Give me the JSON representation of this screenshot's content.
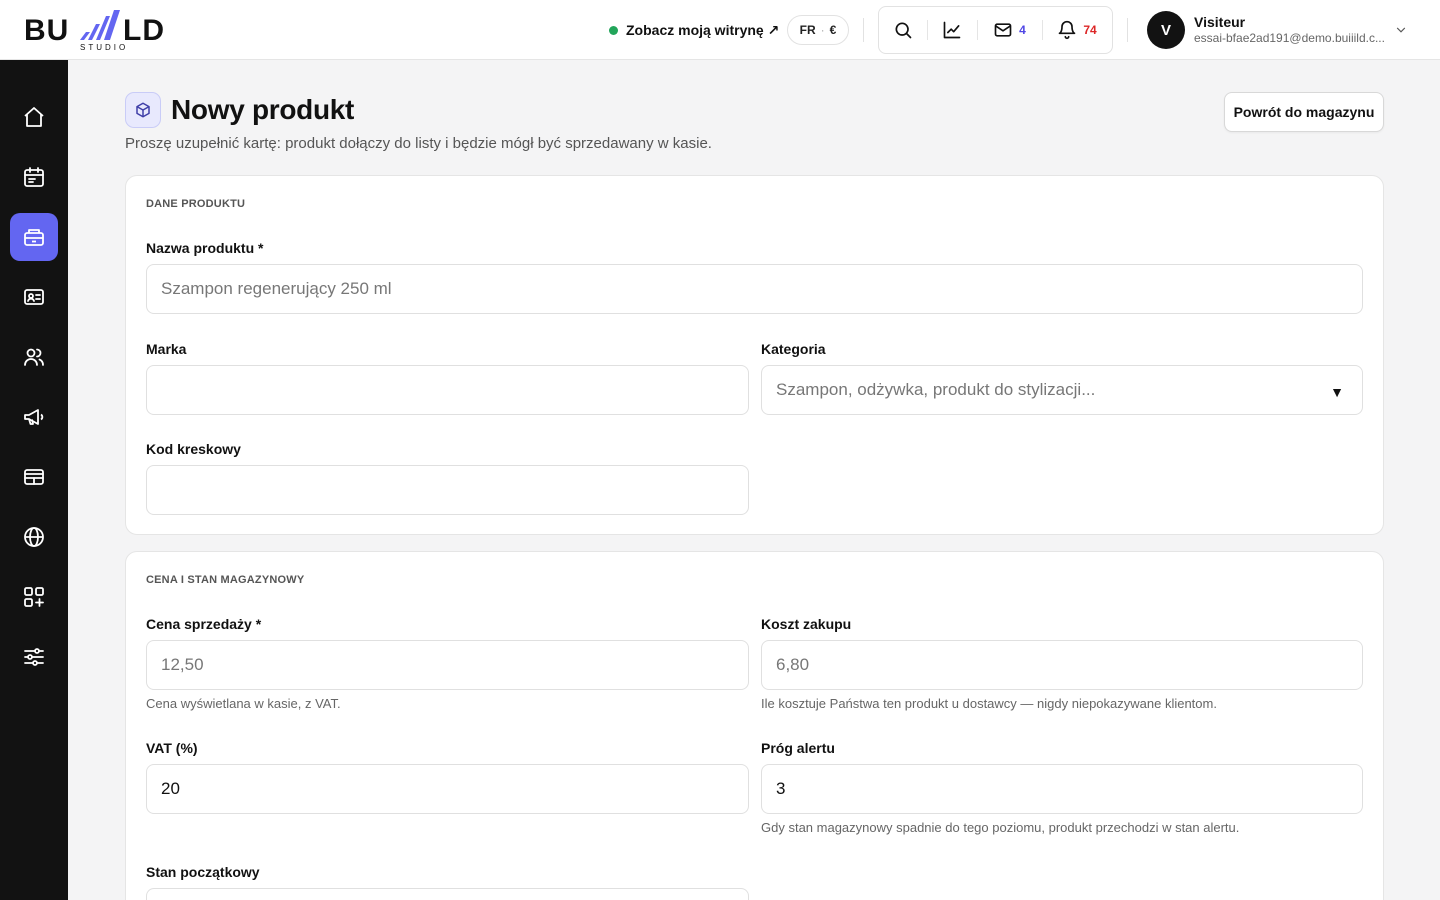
{
  "app": {
    "brand": "BUILLD",
    "brand_sub": "STUDIO"
  },
  "header": {
    "site_link": "Zobacz moją witrynę ↗",
    "language": "FR",
    "currency": "€",
    "messages_count": "4",
    "notifications_count": "74",
    "user": {
      "initial": "V",
      "name": "Visiteur",
      "email": "essai-bfae2ad191@demo.buiiild.c..."
    }
  },
  "sidebar": {
    "items": [
      {
        "name": "home",
        "icon": "home-icon",
        "active": false
      },
      {
        "name": "calendar",
        "icon": "calendar-icon",
        "active": false
      },
      {
        "name": "inventory",
        "icon": "inventory-icon",
        "active": true
      },
      {
        "name": "contacts",
        "icon": "id-card-icon",
        "active": false
      },
      {
        "name": "team",
        "icon": "users-icon",
        "active": false
      },
      {
        "name": "marketing",
        "icon": "megaphone-icon",
        "active": false
      },
      {
        "name": "register",
        "icon": "cash-register-icon",
        "active": false
      },
      {
        "name": "website",
        "icon": "globe-icon",
        "active": false
      },
      {
        "name": "apps",
        "icon": "apps-grid-icon",
        "active": false
      },
      {
        "name": "settings",
        "icon": "sliders-icon",
        "active": false
      }
    ]
  },
  "page": {
    "title": "Nowy produkt",
    "subtitle": "Proszę uzupełnić kartę: produkt dołączy do listy i będzie mógł być sprzedawany w kasie.",
    "back_button": "Powrót do magazynu"
  },
  "product_section": {
    "title": "DANE PRODUKTU",
    "name_label": "Nazwa produktu *",
    "name_placeholder": "Szampon regenerujący 250 ml",
    "brand_label": "Marka",
    "brand_value": "",
    "category_label": "Kategoria",
    "category_placeholder": "Szampon, odżywka, produkt do stylizacji...",
    "barcode_label": "Kod kreskowy",
    "barcode_value": ""
  },
  "price_section": {
    "title": "CENA I STAN MAGAZYNOWY",
    "sale_price_label": "Cena sprzedaży *",
    "sale_price_placeholder": "12,50",
    "sale_price_hint": "Cena wyświetlana w kasie, z VAT.",
    "cost_label": "Koszt zakupu",
    "cost_placeholder": "6,80",
    "cost_hint": "Ile kosztuje Państwa ten produkt u dostawcy — nigdy niepokazywane klientom.",
    "vat_label": "VAT (%)",
    "vat_value": "20",
    "alert_label": "Próg alertu",
    "alert_value": "3",
    "alert_hint": "Gdy stan magazynowy spadnie do tego poziomu, produkt przechodzi w stan alertu.",
    "initial_stock_label": "Stan początkowy"
  },
  "colors": {
    "accent": "#6366f1",
    "sidebar": "#121212",
    "online": "#22a55a",
    "messages": "#4f46e5",
    "notifications": "#dc2626"
  }
}
